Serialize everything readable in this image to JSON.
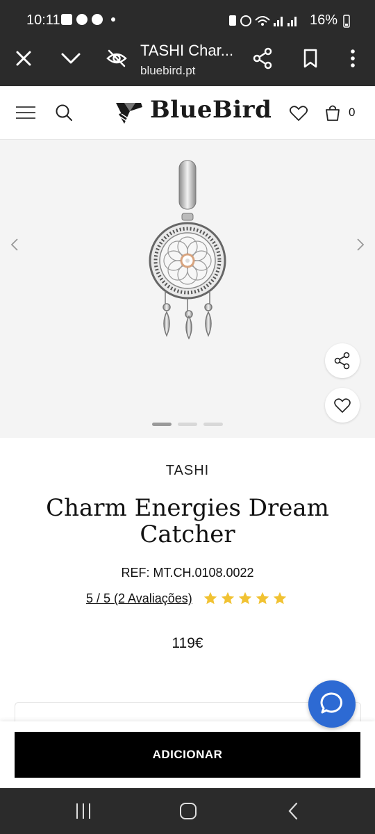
{
  "status_bar": {
    "time": "10:11",
    "battery": "16%"
  },
  "browser": {
    "tab_title": "TASHI Char...",
    "url": "bluebird.pt"
  },
  "site": {
    "logo_text": "BlueBird",
    "cart_count": "0"
  },
  "gallery": {
    "pages": 3,
    "active_page": 1
  },
  "product": {
    "brand": "TASHI",
    "title": "Charm Energies Dream Catcher",
    "ref": "REF: MT.CH.0108.0022",
    "rating_text": "5 / 5 (2 Avaliações)",
    "stars": 5,
    "price": "119€",
    "card_peek_text": "· · · ·"
  },
  "actions": {
    "add_label": "ADICIONAR"
  },
  "colors": {
    "chat_button": "#2d6ad3",
    "star": "#f1c232",
    "system_bar": "#2b2b2b"
  }
}
